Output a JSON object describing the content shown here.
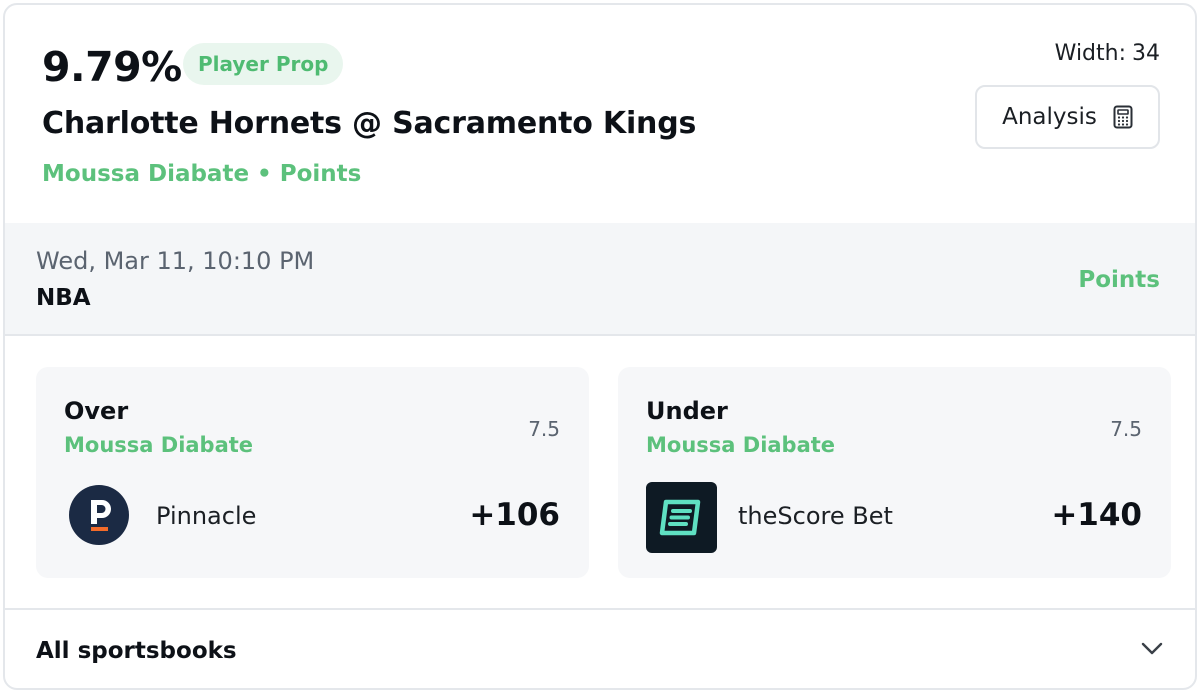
{
  "header": {
    "percentage": "9.79%",
    "badge": "Player Prop",
    "matchup": "Charlotte Hornets @ Sacramento Kings",
    "player": "Moussa Diabate",
    "separator": "•",
    "market": "Points",
    "width_label": "Width:",
    "width_value": "34",
    "analysis_label": "Analysis"
  },
  "info": {
    "datetime": "Wed, Mar 11, 10:10 PM",
    "league": "NBA",
    "market": "Points"
  },
  "offers": [
    {
      "side": "Over",
      "player": "Moussa Diabate",
      "line": "7.5",
      "book": "Pinnacle",
      "odds": "+106",
      "logo_icon": "pinnacle-logo"
    },
    {
      "side": "Under",
      "player": "Moussa Diabate",
      "line": "7.5",
      "book": "theScore Bet",
      "odds": "+140",
      "logo_icon": "thescore-bet-logo"
    }
  ],
  "footer": {
    "label": "All sportsbooks",
    "icon": "chevron-down-icon"
  },
  "colors": {
    "accent_green": "#5cc17c",
    "badge_bg": "#e9f6ee",
    "pinnacle_navy": "#1b2a44",
    "pinnacle_orange": "#f26b2a",
    "thescore_bg": "#0e1a24",
    "thescore_mint": "#5fe0c2"
  }
}
